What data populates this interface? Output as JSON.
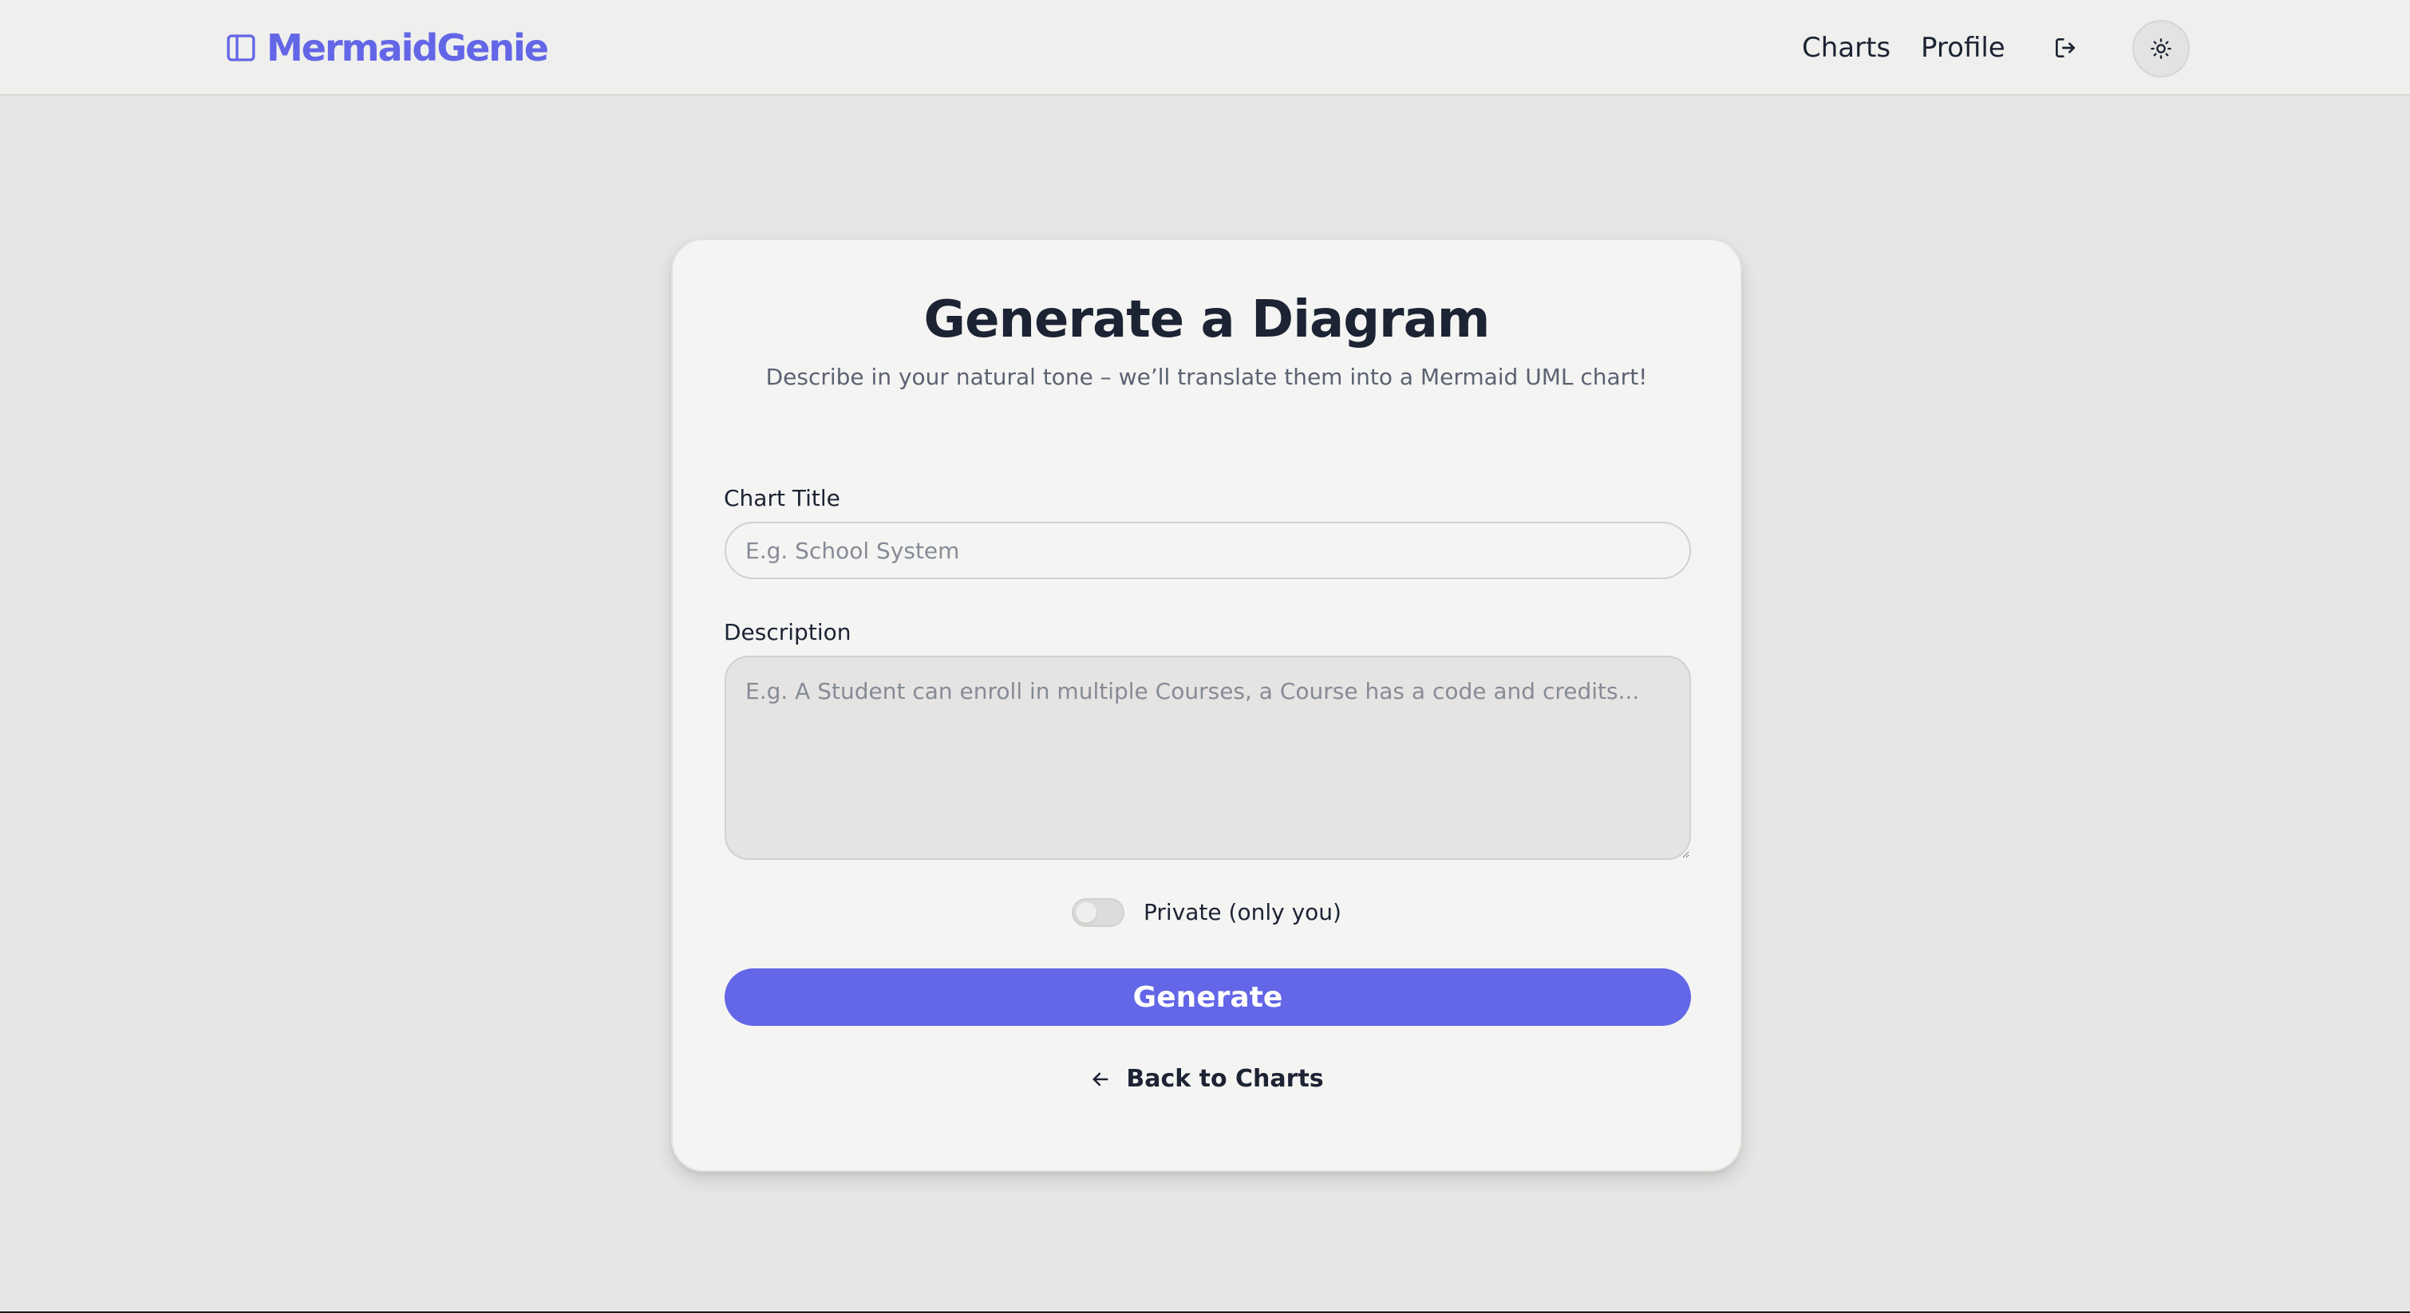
{
  "header": {
    "brand_name": "MermaidGenie",
    "brand_icon": "sidebar-panel-icon",
    "nav": {
      "charts": "Charts",
      "profile": "Profile"
    },
    "icons": {
      "logout": "logout-icon",
      "theme": "sun-icon"
    }
  },
  "form": {
    "title": "Generate a Diagram",
    "subtitle": "Describe in your natural tone – we’ll translate them into a Mermaid UML chart!",
    "chart_title": {
      "label": "Chart Title",
      "value": "",
      "placeholder": "E.g. School System"
    },
    "description": {
      "label": "Description",
      "value": "",
      "placeholder": "E.g. A Student can enroll in multiple Courses, a Course has a code and credits..."
    },
    "private_toggle": {
      "label": "Private (only you)",
      "checked": false
    },
    "generate_label": "Generate",
    "back_label": "Back to Charts"
  },
  "colors": {
    "accent": "#6366e6",
    "page_background": "#e7e6e4",
    "card_background": "#f4f4f3",
    "text": "#1c2333",
    "muted_text": "#5c6272"
  }
}
